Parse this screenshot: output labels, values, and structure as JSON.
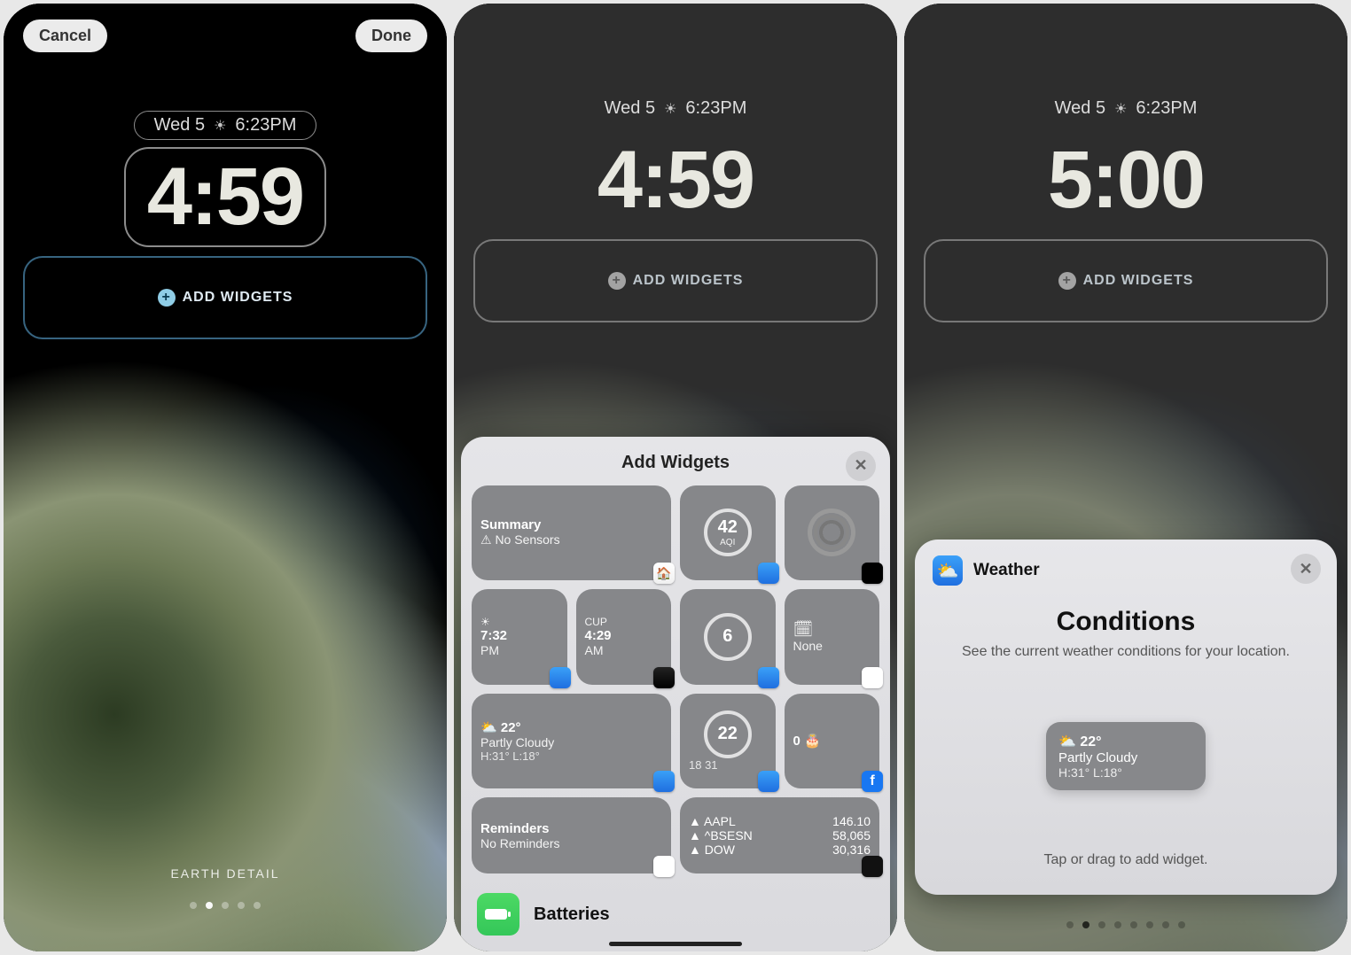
{
  "shared": {
    "date_label": "Wed 5",
    "sunset_time": "6:23PM",
    "add_widgets_label": "ADD WIDGETS"
  },
  "p1": {
    "cancel": "Cancel",
    "done": "Done",
    "time": "4:59",
    "wallpaper_name": "EARTH DETAIL"
  },
  "p2": {
    "time": "4:59",
    "sheet_title": "Add Widgets",
    "widgets": {
      "summary_title": "Summary",
      "summary_sub": "⚠  No Sensors",
      "aqi_value": "42",
      "aqi_label": "AQI",
      "clock1_city": "",
      "clock1_time": "7:32",
      "clock1_ampm": "PM",
      "clock2_city": "CUP",
      "clock2_time": "4:29",
      "clock2_ampm": "AM",
      "uv_value": "6",
      "cal_label": "None",
      "cond_temp": "22°",
      "cond_desc": "Partly Cloudy",
      "cond_hilo": "H:31° L:18°",
      "moon_value": "22",
      "moon_sub": "18  31",
      "bday_value": "0",
      "rem_title": "Reminders",
      "rem_sub": "No Reminders",
      "stocks": [
        {
          "sym": "▲ AAPL",
          "val": "146.10"
        },
        {
          "sym": "▲ ^BSESN",
          "val": "58,065"
        },
        {
          "sym": "▲ DOW",
          "val": "30,316"
        }
      ]
    },
    "category_name": "Batteries"
  },
  "p3": {
    "time": "5:00",
    "app_name": "Weather",
    "detail_title": "Conditions",
    "detail_sub": "See the current weather conditions for your location.",
    "preview_temp": "22°",
    "preview_desc": "Partly Cloudy",
    "preview_hilo": "H:31° L:18°",
    "hint": "Tap or drag to add widget."
  }
}
